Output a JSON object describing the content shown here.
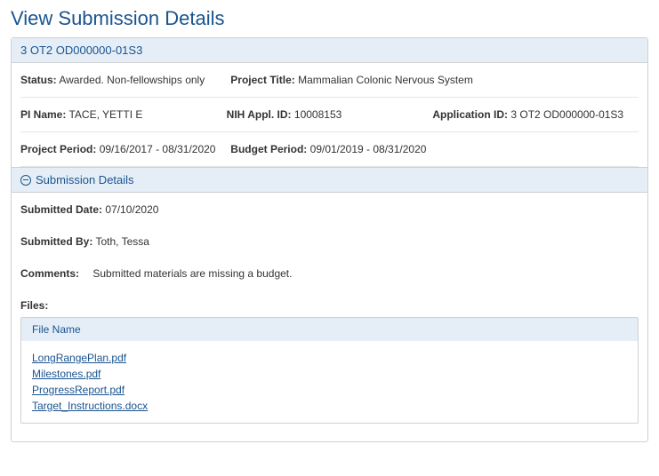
{
  "page": {
    "title": "View Submission Details"
  },
  "header": {
    "grant_number": "3 OT2 OD000000-01S3"
  },
  "info": {
    "status_label": "Status:",
    "status_value": "Awarded. Non-fellowships only",
    "project_title_label": "Project Title:",
    "project_title_value": "Mammalian Colonic Nervous System",
    "pi_name_label": "PI Name:",
    "pi_name_value": "TACE, YETTI E",
    "nih_appl_id_label": "NIH Appl. ID:",
    "nih_appl_id_value": "10008153",
    "application_id_label": "Application ID:",
    "application_id_value": "3 OT2 OD000000-01S3",
    "project_period_label": "Project Period:",
    "project_period_value": "09/16/2017 - 08/31/2020",
    "budget_period_label": "Budget Period:",
    "budget_period_value": "09/01/2019 - 08/31/2020"
  },
  "submission": {
    "section_title": "Submission Details",
    "submitted_date_label": "Submitted Date:",
    "submitted_date_value": "07/10/2020",
    "submitted_by_label": "Submitted By:",
    "submitted_by_value": "Toth, Tessa",
    "comments_label": "Comments:",
    "comments_value": "Submitted materials are missing a budget.",
    "files_label": "Files:",
    "file_name_header": "File Name",
    "files": [
      "LongRangePlan.pdf",
      "Milestones.pdf",
      "ProgressReport.pdf",
      "Target_Instructions.docx"
    ]
  }
}
